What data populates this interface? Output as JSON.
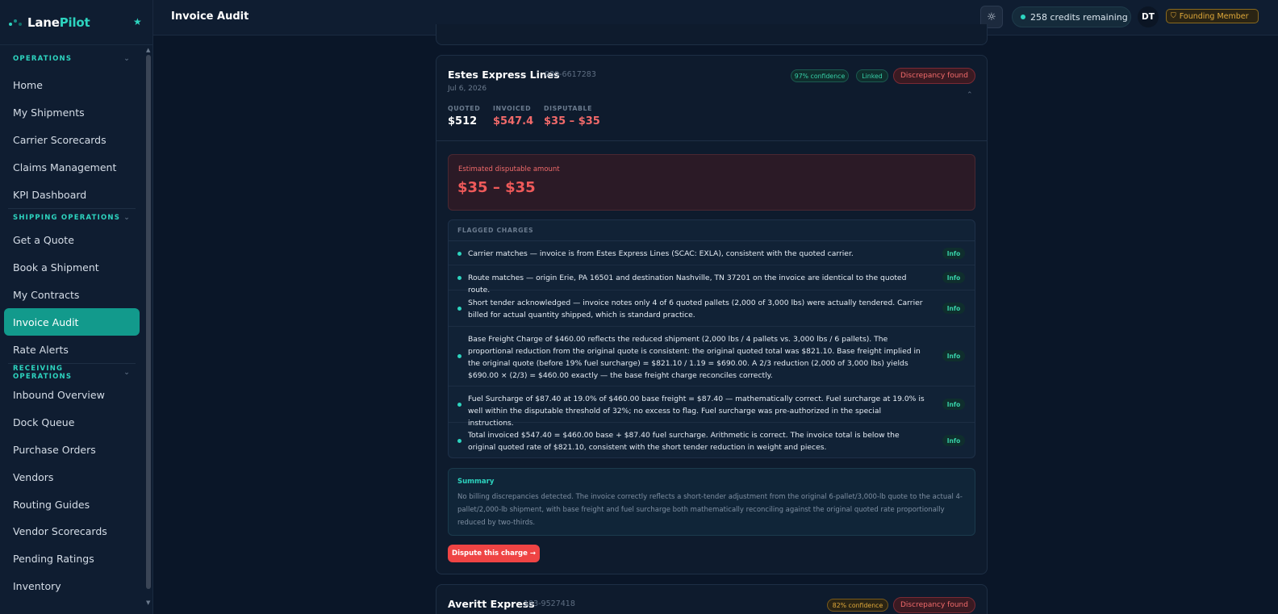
{
  "app": {
    "brand_first": "Lane",
    "brand_second": "Pilot",
    "page_title": "Invoice Audit"
  },
  "header": {
    "theme_icon": "sun-icon",
    "credits": "258 credits remaining",
    "avatar": "DT",
    "member": "Founding Member"
  },
  "sidebar": {
    "sections": [
      {
        "title": "OPERATIONS",
        "items": [
          "Home",
          "My Shipments",
          "Carrier Scorecards",
          "Claims Management",
          "KPI Dashboard"
        ]
      },
      {
        "title": "SHIPPING OPERATIONS",
        "items": [
          "Get a Quote",
          "Book a Shipment",
          "My Contracts",
          "Invoice Audit",
          "Rate Alerts"
        ]
      },
      {
        "title": "RECEIVING OPERATIONS",
        "items": [
          "Inbound Overview",
          "Dock Queue",
          "Purchase Orders",
          "Vendors",
          "Routing Guides",
          "Vendor Scorecards",
          "Pending Ratings",
          "Inventory"
        ]
      }
    ],
    "active": "Invoice Audit"
  },
  "card": {
    "carrier": "Estes Express Lines",
    "pro": "039-6617283",
    "date": "Jul 6, 2026",
    "confidence": "97% confidence",
    "linked": "Linked",
    "status": "Discrepancy found",
    "metrics": [
      {
        "label": "QUOTED",
        "value": "$512"
      },
      {
        "label": "INVOICED",
        "value": "$547.4"
      },
      {
        "label": "DISPUTABLE",
        "value": "$35 – $35"
      }
    ],
    "estimate_label": "Estimated disputable amount",
    "estimate_value": "$35 – $35",
    "flagged_title": "FLAGGED CHARGES",
    "flags": [
      {
        "text": "Carrier matches — invoice is from Estes Express Lines (SCAC: EXLA), consistent with the quoted carrier.",
        "tag": "Info"
      },
      {
        "text": "Route matches — origin Erie, PA 16501 and destination Nashville, TN 37201 on the invoice are identical to the quoted route.",
        "tag": "Info"
      },
      {
        "text": "Short tender acknowledged — invoice notes only 4 of 6 quoted pallets (2,000 of 3,000 lbs) were actually tendered. Carrier billed for actual quantity shipped, which is standard practice.",
        "tag": "Info"
      },
      {
        "text": "Base Freight Charge of $460.00 reflects the reduced shipment (2,000 lbs / 4 pallets vs. 3,000 lbs / 6 pallets). The proportional reduction from the original quote is consistent: the original quoted total was $821.10. Base freight implied in the original quote (before 19% fuel surcharge) = $821.10 / 1.19 = $690.00. A 2/3 reduction (2,000 of 3,000 lbs) yields $690.00 × (2/3) = $460.00 exactly — the base freight charge reconciles correctly.",
        "tag": "Info"
      },
      {
        "text": "Fuel Surcharge of $87.40 at 19.0% of $460.00 base freight = $87.40 — mathematically correct. Fuel surcharge at 19.0% is well within the disputable threshold of 32%; no excess to flag. Fuel surcharge was pre-authorized in the special instructions.",
        "tag": "Info"
      },
      {
        "text": "Total invoiced $547.40 = $460.00 base + $87.40 fuel surcharge. Arithmetic is correct. The invoice total is below the original quoted rate of $821.10, consistent with the short tender reduction in weight and pieces.",
        "tag": "Info"
      }
    ],
    "summary_title": "Summary",
    "summary_text": "No billing discrepancies detected. The invoice correctly reflects a short-tender adjustment from the original 6-pallet/3,000-lb quote to the actual 4-pallet/2,000-lb shipment, with base freight and fuel surcharge both mathematically reconciling against the original quoted rate proportionally reduced by two-thirds.",
    "dispute_button": "Dispute this charge →"
  },
  "card2": {
    "carrier": "Averitt Express",
    "pro": "183-9527418",
    "confidence": "82% confidence",
    "status": "Discrepancy found"
  },
  "colors": {
    "accent": "#2dd4bf",
    "danger": "#ef4444",
    "active_nav": "#129a8c",
    "background": "#0a1628"
  }
}
